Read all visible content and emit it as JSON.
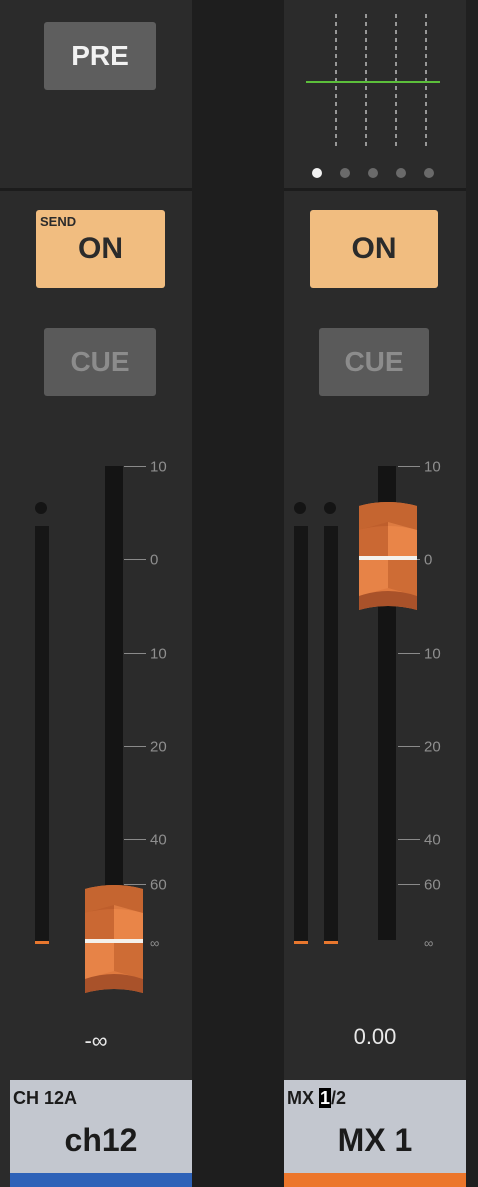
{
  "left_strip": {
    "pre_button": "PRE",
    "send_tag": "SEND",
    "on_button": "ON",
    "cue_button": "CUE",
    "scale_labels": [
      "10",
      "0",
      "10",
      "20",
      "40",
      "60",
      "∞"
    ],
    "fader_readout": "-∞",
    "channel_id": "CH 12A",
    "channel_name": "ch12",
    "color_bar": "#2e62b8"
  },
  "right_strip": {
    "eq_pages": 5,
    "eq_active_page": 1,
    "on_button": "ON",
    "cue_button": "CUE",
    "scale_labels": [
      "10",
      "0",
      "10",
      "20",
      "40",
      "60",
      "∞"
    ],
    "fader_readout": "0.00",
    "channel_id_prefix": "MX ",
    "channel_id_cursor": "1",
    "channel_id_suffix": "/2",
    "channel_name": "MX 1",
    "color_bar": "#ec762b"
  },
  "colors": {
    "on_active": "#f1bd80",
    "fader_orange": "#e07a3f",
    "eq_line": "#5cbf3b",
    "peak": "#e8772e"
  },
  "icons": {
    "fader_knob": "fader-knob-icon",
    "eq_curve": "eq-curve-icon",
    "meter_clip": "meter-clip-indicator-icon"
  }
}
